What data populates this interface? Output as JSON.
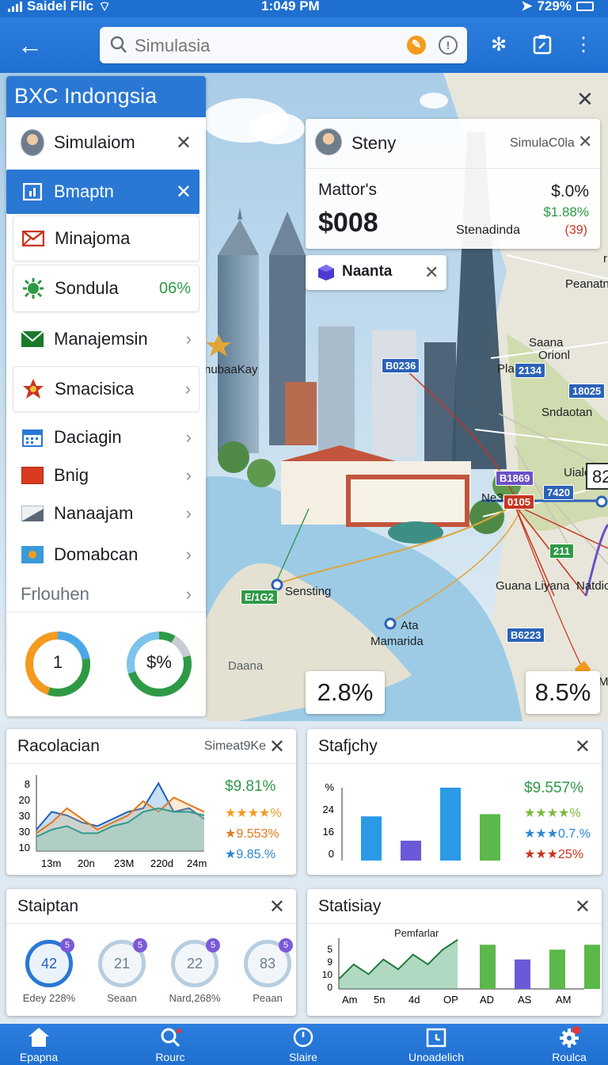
{
  "status_bar": {
    "carrier": "Saidel FIlc",
    "time": "1:049 PM",
    "battery": "729%"
  },
  "search": {
    "placeholder": "Simulasia"
  },
  "left_panel": {
    "title": "BXC Indongsia",
    "items": [
      {
        "label": "Simulaiom"
      },
      {
        "label": "Bmaptn"
      },
      {
        "label": "Minajoma"
      },
      {
        "label": "Sondula",
        "value": "06%"
      },
      {
        "label": "Manajemsin"
      },
      {
        "label": "Smacisica"
      },
      {
        "label": "Daciagin"
      },
      {
        "label": "Bnig"
      },
      {
        "label": "Nanaajam"
      },
      {
        "label": "Domabcan"
      },
      {
        "label": "Frlouhen"
      }
    ],
    "gauges": [
      {
        "label": "1",
        "fraction": 0.55
      },
      {
        "label": "$%",
        "fraction": 0.7
      }
    ]
  },
  "info_card": {
    "name": "Steny",
    "subtitle": "SimulaC0la",
    "metric_label": "Mattor's",
    "metric_value": "$008",
    "pct": "$.0%",
    "change": "$1.88%",
    "caption": "Stenadinda",
    "count": "(39)"
  },
  "place_card": {
    "label": "Naanta"
  },
  "map": {
    "labels": {
      "left_place": "nubaaKay",
      "sensting": "Sensting",
      "ata": "Ata",
      "mamarida": "Mamarida",
      "daana": "Daana",
      "peanatn": "Peanatn",
      "saana": "Saana",
      "orionl": "Orionl",
      "pla": "Pla",
      "sndaotan": "Sndaotan",
      "uiale": "Uiale",
      "ne": "Ne3",
      "guana": "Guana Liyana",
      "natdic": "Natdic",
      "edge_letter": "M",
      "edge_r": "r"
    },
    "tags": {
      "t1": "B0236",
      "t2": "2134",
      "t3": "18025",
      "t4": "B1869",
      "t5": "7420",
      "t6": "0105",
      "t7": "211",
      "t8": "B6223",
      "t9": "E/1G2"
    },
    "edge_box": "82",
    "pct_left": "2.8%",
    "pct_right": "8.5%"
  },
  "panel_racolacian": {
    "title": "Racolacian",
    "subtitle": "Simeat9Ke",
    "stats": [
      "$9.81%",
      "★★★★%",
      "★9.553%",
      "★9.85.%"
    ],
    "chart_data": {
      "type": "area",
      "x": [
        "13m",
        "20n",
        "23M",
        "220d",
        "24m"
      ],
      "y_ticks": [
        "8",
        "20",
        "30",
        "30",
        "10"
      ],
      "series": [
        {
          "values": [
            12,
            22,
            20,
            16,
            14,
            18,
            22,
            24,
            38,
            22,
            24,
            18
          ]
        },
        {
          "values": [
            10,
            16,
            24,
            18,
            12,
            16,
            20,
            28,
            22,
            30,
            26,
            22
          ]
        },
        {
          "values": [
            8,
            12,
            14,
            10,
            10,
            14,
            16,
            22,
            24,
            22,
            22,
            20
          ]
        }
      ]
    }
  },
  "panel_stafjchy": {
    "title": "Stafjchy",
    "stats": [
      "$9.557%",
      "★★★★%",
      "★★★0.7.%",
      "★★★25%"
    ],
    "chart_data": {
      "type": "bar",
      "y_ticks": [
        "%",
        "24",
        "16",
        "0"
      ],
      "values": [
        20,
        9,
        33,
        21
      ]
    }
  },
  "panel_staiptan": {
    "title": "Staiptan",
    "gauges": [
      {
        "value": "42",
        "label": "Edey 228%",
        "badge": "5"
      },
      {
        "value": "21",
        "label": "Seaan",
        "badge": "5"
      },
      {
        "value": "22",
        "label": "Nard,268%",
        "badge": "5"
      },
      {
        "value": "83",
        "label": "Peaan",
        "badge": "5"
      }
    ]
  },
  "panel_statisiay": {
    "title": "Statisiay",
    "annotation": "Pemfarlar",
    "chart_data": {
      "type": "area",
      "x": [
        "Am",
        "5n",
        "4d",
        "OP",
        "AD",
        "AS",
        "AM"
      ],
      "y_ticks": [
        "5",
        "9",
        "10",
        "0"
      ],
      "series": [
        {
          "values": [
            2,
            5,
            3,
            6,
            4,
            7,
            5,
            8,
            10
          ]
        }
      ],
      "bars": [
        9,
        6,
        8,
        9
      ]
    }
  },
  "nav": {
    "items": [
      {
        "label": "Epapna",
        "icon": "home-icon"
      },
      {
        "label": "Rourc",
        "icon": "search-icon"
      },
      {
        "label": "Slaire",
        "icon": "clock-icon"
      },
      {
        "label": "Unoadelich",
        "icon": "calendar-icon"
      },
      {
        "label": "Roulca",
        "icon": "gear-icon"
      }
    ]
  },
  "colors": {
    "brand": "#1f6fd0",
    "panel_head": "#2a78d4",
    "green": "#2f9a46",
    "orange": "#f39a1f",
    "red": "#c8351f"
  }
}
